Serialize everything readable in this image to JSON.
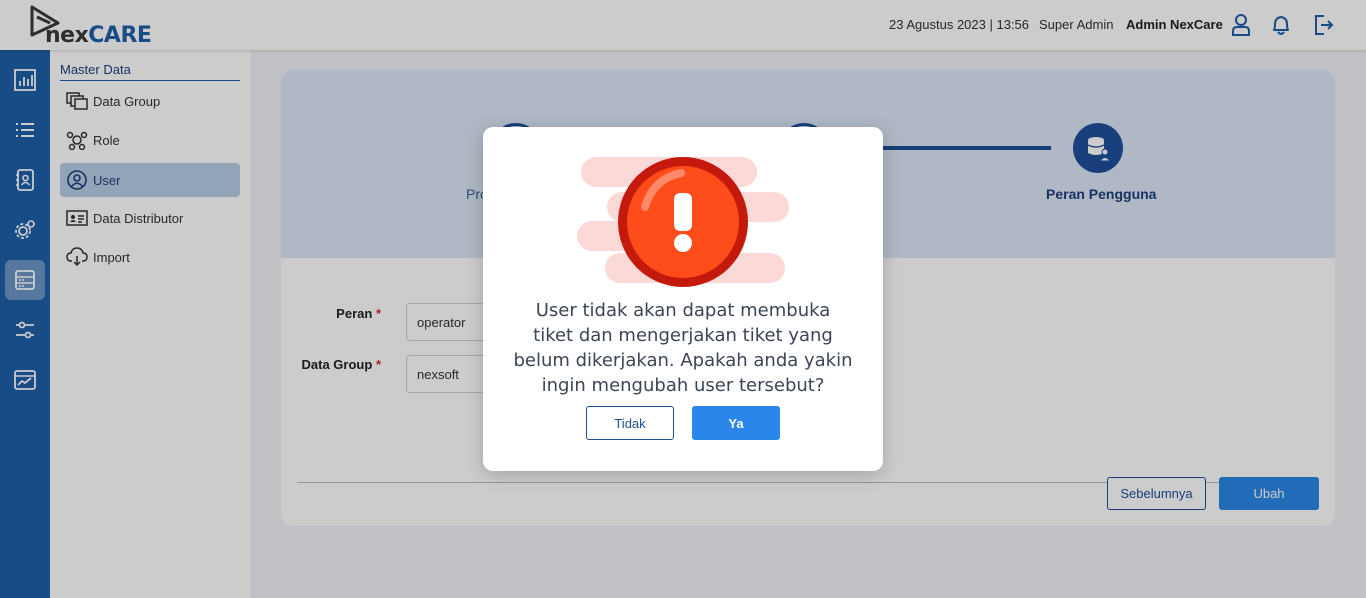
{
  "header": {
    "logo_prefix": "nex",
    "logo_suffix": "CARE",
    "datetime": "23 Agustus 2023 | 13:56",
    "role": "Super Admin",
    "user_name": "Admin NexCare"
  },
  "submenu": {
    "title": "Master Data",
    "items": [
      {
        "label": "Data Group",
        "icon": "folders-icon"
      },
      {
        "label": "Role",
        "icon": "role-network-icon"
      },
      {
        "label": "User",
        "icon": "user-circle-icon",
        "active": true
      },
      {
        "label": "Data Distributor",
        "icon": "id-card-icon"
      },
      {
        "label": "Import",
        "icon": "cloud-download-icon"
      }
    ]
  },
  "stepper": {
    "steps": [
      {
        "label": "Pro"
      },
      {
        "label": ""
      },
      {
        "label": "Peran Pengguna"
      }
    ]
  },
  "form": {
    "role_label": "Peran",
    "role_value": "operator",
    "group_label": "Data Group",
    "group_value": "nexsoft",
    "required_mark": "*",
    "prev_button": "Sebelumnya",
    "submit_button": "Ubah"
  },
  "modal": {
    "message": "User tidak akan dapat membuka tiket dan mengerjakan tiket yang belum dikerjakan. Apakah anda yakin ingin mengubah user tersebut?",
    "no_button": "Tidak",
    "yes_button": "Ya"
  },
  "colors": {
    "primary": "#1f5fa8",
    "button_primary": "#2a86e8",
    "warning": "#e8361c"
  }
}
